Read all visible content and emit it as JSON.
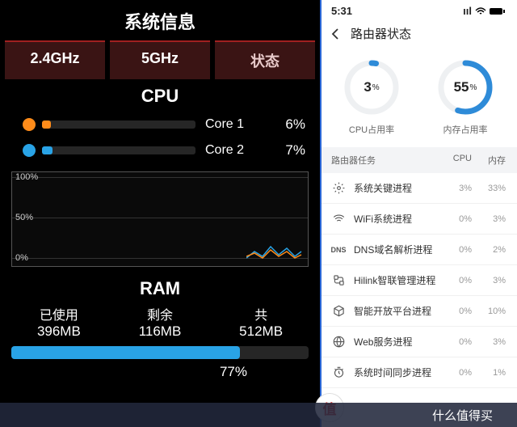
{
  "left": {
    "title": "系统信息",
    "tabs": [
      "2.4GHz",
      "5GHz",
      "状态"
    ],
    "active_tab": 2,
    "cpu": {
      "heading": "CPU",
      "cores": [
        {
          "label": "Core 1",
          "pct": "6%",
          "value": 6,
          "color": "#ff8c1a"
        },
        {
          "label": "Core 2",
          "pct": "7%",
          "value": 7,
          "color": "#29a3e6"
        }
      ],
      "graph": {
        "ticks": [
          "100%",
          "50%",
          "0%"
        ]
      }
    },
    "ram": {
      "heading": "RAM",
      "used_label": "已使用",
      "used_value": "396MB",
      "free_label": "剩余",
      "free_value": "116MB",
      "total_label": "共",
      "total_value": "512MB",
      "pct_label": "77%",
      "pct_value": 77
    }
  },
  "right": {
    "status_time": "5:31",
    "nav_title": "路由器状态",
    "gauges": [
      {
        "label": "CPU占用率",
        "value": 3,
        "text": "3",
        "unit": "%"
      },
      {
        "label": "内存占用率",
        "value": 55,
        "text": "55",
        "unit": "%"
      }
    ],
    "table": {
      "head": {
        "name": "路由器任务",
        "cpu": "CPU",
        "mem": "内存"
      },
      "rows": [
        {
          "icon": "gear",
          "name": "系统关键进程",
          "cpu": "3%",
          "mem": "33%"
        },
        {
          "icon": "wifi",
          "name": "WiFi系统进程",
          "cpu": "0%",
          "mem": "3%"
        },
        {
          "icon": "dns",
          "name": "DNS域名解析进程",
          "cpu": "0%",
          "mem": "2%"
        },
        {
          "icon": "link",
          "name": "Hilink智联管理进程",
          "cpu": "0%",
          "mem": "3%"
        },
        {
          "icon": "box",
          "name": "智能开放平台进程",
          "cpu": "0%",
          "mem": "10%"
        },
        {
          "icon": "globe",
          "name": "Web服务进程",
          "cpu": "0%",
          "mem": "3%"
        },
        {
          "icon": "clock",
          "name": "系统时间同步进程",
          "cpu": "0%",
          "mem": "1%"
        }
      ]
    }
  },
  "footer": {
    "badge": "值",
    "text": "什么值得买"
  },
  "chart_data": {
    "type": "line",
    "title": "CPU usage over time",
    "ylabel": "%",
    "ylim": [
      0,
      100
    ],
    "series": [
      {
        "name": "Core 1",
        "color": "#ff8c1a",
        "values": [
          4,
          6,
          5,
          7,
          6,
          8,
          6
        ]
      },
      {
        "name": "Core 2",
        "color": "#29a3e6",
        "values": [
          5,
          7,
          6,
          8,
          7,
          9,
          7
        ]
      }
    ]
  }
}
